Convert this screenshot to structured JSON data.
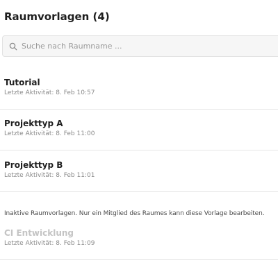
{
  "header": {
    "title": "Raumvorlagen (4)"
  },
  "search": {
    "placeholder": "Suche nach Raumname ...",
    "value": ""
  },
  "rooms": [
    {
      "name": "Tutorial",
      "activity": "Letzte Aktivität: 8. Feb 10:57"
    },
    {
      "name": "Projekttyp A",
      "activity": "Letzte Aktivität: 8. Feb 11:00"
    },
    {
      "name": "Projekttyp B",
      "activity": "Letzte Aktivität: 8. Feb 11:01"
    }
  ],
  "inactive": {
    "note": "Inaktive Raumvorlagen. Nur ein Mitglied des Raumes kann diese Vorlage bearbeiten.",
    "rooms": [
      {
        "name": "CI Entwicklung",
        "activity": "Letzte Aktivität: 8. Feb 11:09"
      }
    ]
  }
}
